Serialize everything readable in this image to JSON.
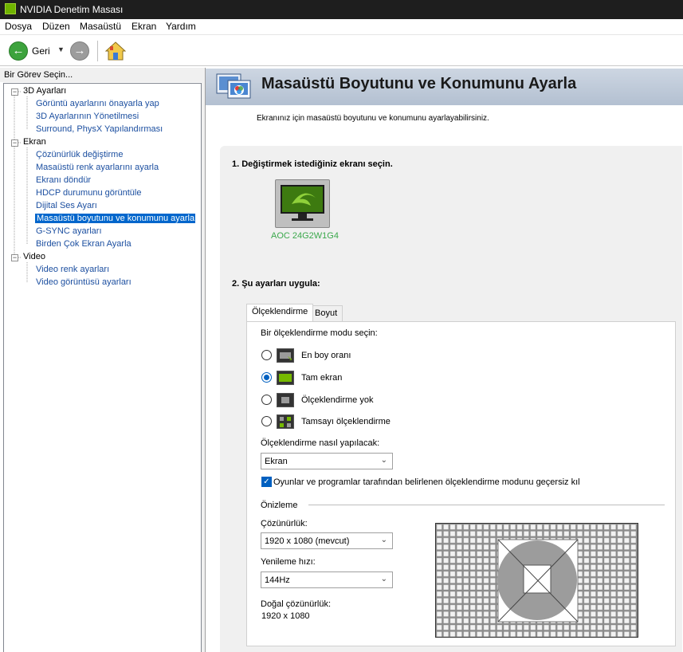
{
  "window": {
    "title": "NVIDIA Denetim Masası"
  },
  "menu": [
    "Dosya",
    "Düzen",
    "Masaüstü",
    "Ekran",
    "Yardım"
  ],
  "toolbar": {
    "back_label": "Geri"
  },
  "sidebar": {
    "header": "Bir Görev Seçin...",
    "categories": [
      {
        "label": "3D Ayarları",
        "items": [
          "Görüntü ayarlarını önayarla yap",
          "3D Ayarlarının Yönetilmesi",
          "Surround, PhysX Yapılandırması"
        ]
      },
      {
        "label": "Ekran",
        "items": [
          "Çözünürlük değiştirme",
          "Masaüstü renk ayarlarını ayarla",
          "Ekranı döndür",
          "HDCP durumunu görüntüle",
          "Dijital Ses Ayarı",
          "Masaüstü boyutunu ve konumunu ayarla",
          "G-SYNC ayarları",
          "Birden Çok Ekran Ayarla"
        ]
      },
      {
        "label": "Video",
        "items": [
          "Video renk ayarları",
          "Video görüntüsü ayarları"
        ]
      }
    ],
    "selected": "Masaüstü boyutunu ve konumunu ayarla"
  },
  "page": {
    "title": "Masaüstü Boyutunu ve Konumunu Ayarla",
    "description": "Ekranınız için masaüstü boyutunu ve konumunu ayarlayabilirsiniz.",
    "step1": "1. Değiştirmek istediğiniz ekranı seçin.",
    "monitor_label": "AOC 24G2W1G4",
    "step2": "2. Şu ayarları uygula:"
  },
  "tabs": [
    "Ölçeklendirme",
    "Boyut"
  ],
  "scaling": {
    "mode_prompt": "Bir ölçeklendirme modu seçin:",
    "modes": [
      "En boy oranı",
      "Tam ekran",
      "Ölçeklendirme yok",
      "Tamsayı ölçeklendirme"
    ],
    "selected_mode": "Tam ekran",
    "perform_label": "Ölçeklendirme nasıl yapılacak:",
    "perform_value": "Ekran",
    "override_label": "Oyunlar ve programlar tarafından belirlenen ölçeklendirme modunu geçersiz kıl",
    "override_checked": true,
    "preview_label": "Önizleme",
    "resolution_label": "Çözünürlük:",
    "resolution_value": "1920 x 1080 (mevcut)",
    "refresh_label": "Yenileme hızı:",
    "refresh_value": "144Hz",
    "native_label": "Doğal çözünürlük:",
    "native_value": "1920 x 1080"
  },
  "colors": {
    "accent": "#0060c0",
    "nvidia_green": "#76b900",
    "banner": "#c3cddb"
  }
}
